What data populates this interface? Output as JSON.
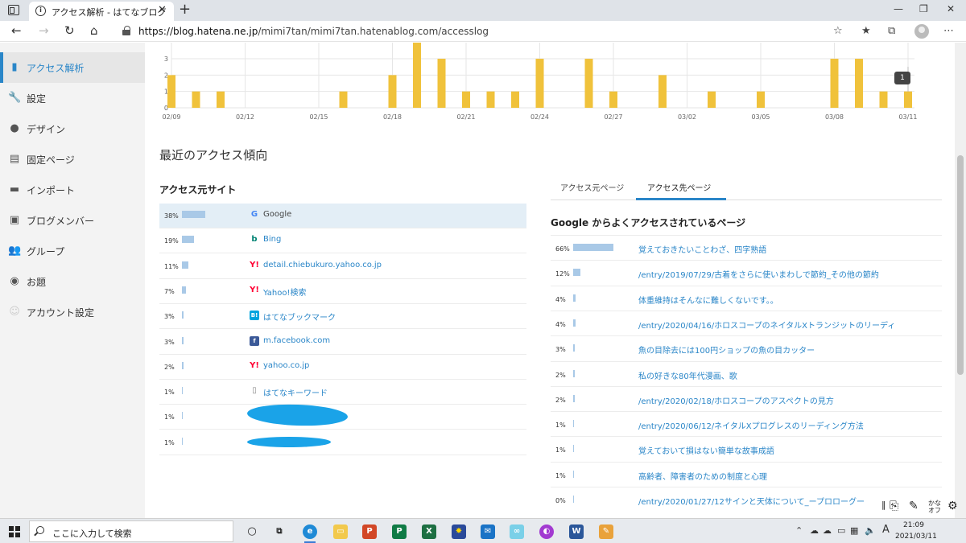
{
  "browser": {
    "tab_title": "アクセス解析 - はてなブログ",
    "url_host": "https://blog.hatena.ne.jp",
    "url_path": "/mimi7tan/mimi7tan.hatenablog.com/accesslog"
  },
  "sidebar": {
    "items": [
      {
        "label": "アクセス解析",
        "icon": "bar-chart-icon"
      },
      {
        "label": "設定",
        "icon": "wrench-icon"
      },
      {
        "label": "デザイン",
        "icon": "palette-icon"
      },
      {
        "label": "固定ページ",
        "icon": "page-icon"
      },
      {
        "label": "インポート",
        "icon": "truck-icon"
      },
      {
        "label": "ブログメンバー",
        "icon": "members-icon"
      },
      {
        "label": "グループ",
        "icon": "group-icon"
      },
      {
        "label": "お題",
        "icon": "topic-icon"
      },
      {
        "label": "アカウント設定",
        "icon": "account-icon"
      }
    ]
  },
  "chart_data": {
    "type": "bar",
    "x_tick_labels": [
      "02/09",
      "02/12",
      "02/15",
      "02/18",
      "02/21",
      "02/24",
      "02/27",
      "03/02",
      "03/05",
      "03/08",
      "03/11"
    ],
    "categories": [
      "02/09",
      "02/10",
      "02/11",
      "02/12",
      "02/13",
      "02/14",
      "02/15",
      "02/16",
      "02/17",
      "02/18",
      "02/19",
      "02/20",
      "02/21",
      "02/22",
      "02/23",
      "02/24",
      "02/25",
      "02/26",
      "02/27",
      "02/28",
      "03/01",
      "03/02",
      "03/03",
      "03/04",
      "03/05",
      "03/06",
      "03/07",
      "03/08",
      "03/09",
      "03/10",
      "03/11"
    ],
    "values": [
      2,
      1,
      1,
      0,
      0,
      0,
      0,
      1,
      0,
      2,
      4,
      3,
      1,
      1,
      1,
      3,
      0,
      3,
      1,
      0,
      2,
      0,
      1,
      0,
      1,
      0,
      0,
      3,
      3,
      1,
      1
    ],
    "y_tick_labels": [
      "0",
      "1",
      "2",
      "3"
    ],
    "ylim": [
      0,
      3.1
    ],
    "grid": true,
    "bar_color": "#f0c23b",
    "tooltip_value": "1"
  },
  "recent": {
    "title": "最近のアクセス傾向",
    "sources_title": "アクセス元サイト",
    "sources": [
      {
        "pct": "38%",
        "value": 38,
        "name": "Google",
        "icon": "google-icon",
        "link": false
      },
      {
        "pct": "19%",
        "value": 19,
        "name": "Bing",
        "icon": "bing-icon",
        "link": true
      },
      {
        "pct": "11%",
        "value": 11,
        "name": "detail.chiebukuro.yahoo.co.jp",
        "icon": "yahoo-icon",
        "link": true
      },
      {
        "pct": "7%",
        "value": 7,
        "name": "Yahoo!検索",
        "icon": "yahoo-icon",
        "link": true
      },
      {
        "pct": "3%",
        "value": 3,
        "name": "はてなブックマーク",
        "icon": "hatena-bookmark-icon",
        "link": true
      },
      {
        "pct": "3%",
        "value": 3,
        "name": "m.facebook.com",
        "icon": "facebook-icon",
        "link": true
      },
      {
        "pct": "2%",
        "value": 2,
        "name": "yahoo.co.jp",
        "icon": "yahoo-icon",
        "link": true
      },
      {
        "pct": "1%",
        "value": 1,
        "name": "はてなキーワード",
        "icon": "document-icon",
        "link": true
      },
      {
        "pct": "1%",
        "value": 1,
        "name": "",
        "icon": "",
        "link": true
      },
      {
        "pct": "1%",
        "value": 1,
        "name": "",
        "icon": "",
        "link": true
      }
    ],
    "tabs": [
      "アクセス元ページ",
      "アクセス先ページ"
    ],
    "dest_title": "Google からよくアクセスされているページ",
    "destinations": [
      {
        "pct": "66%",
        "value": 66,
        "title": "覚えておきたいことわざ、四字熟語"
      },
      {
        "pct": "12%",
        "value": 12,
        "title": "/entry/2019/07/29/古着をさらに使いまわしで節約_その他の節約"
      },
      {
        "pct": "4%",
        "value": 4,
        "title": "体重維持はそんなに難しくないです。。"
      },
      {
        "pct": "4%",
        "value": 4,
        "title": "/entry/2020/04/16/ホロスコープのネイタルXトランジットのリーディ"
      },
      {
        "pct": "3%",
        "value": 3,
        "title": "魚の目除去には100円ショップの魚の目カッター"
      },
      {
        "pct": "2%",
        "value": 2,
        "title": "私の好きな80年代漫画、歌"
      },
      {
        "pct": "2%",
        "value": 2,
        "title": "/entry/2020/02/18/ホロスコープのアスペクトの見方"
      },
      {
        "pct": "1%",
        "value": 1,
        "title": "/entry/2020/06/12/ネイタルXプログレスのリーディング方法"
      },
      {
        "pct": "1%",
        "value": 1,
        "title": "覚えておいて損はない簡単な故事成語"
      },
      {
        "pct": "1%",
        "value": 1,
        "title": "高齢者、障害者のための制度と心理"
      },
      {
        "pct": "0%",
        "value": 0,
        "title": "/entry/2020/01/27/12サインと天体について_ープロローグー"
      }
    ]
  },
  "ime": {
    "mode": "かな\nオフ"
  },
  "taskbar": {
    "search_placeholder": "ここに入力して検索",
    "input_indicator": "A",
    "time": "21:09",
    "date": "2021/03/11"
  }
}
